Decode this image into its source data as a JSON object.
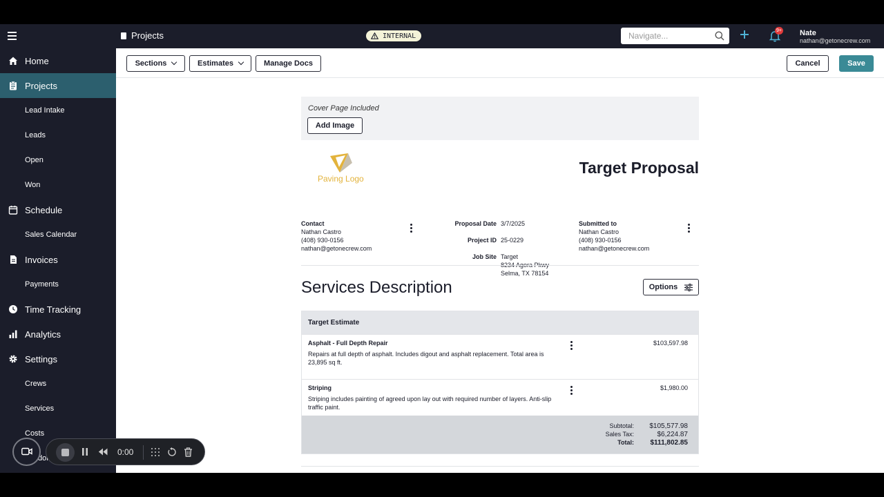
{
  "topbar": {
    "title": "Projects",
    "badge": "INTERNAL",
    "navigate_placeholder": "Navigate...",
    "notif_count": "9+",
    "user_name": "Nate",
    "user_email": "nathan@getonecrew.com"
  },
  "sidebar": {
    "items": [
      {
        "label": "Home",
        "icon": "home-icon",
        "sub": false
      },
      {
        "label": "Projects",
        "icon": "clipboard-icon",
        "sub": false,
        "active": true
      },
      {
        "label": "Lead Intake",
        "sub": true
      },
      {
        "label": "Leads",
        "sub": true
      },
      {
        "label": "Open",
        "sub": true
      },
      {
        "label": "Won",
        "sub": true
      },
      {
        "label": "Schedule",
        "icon": "calendar-icon",
        "sub": false
      },
      {
        "label": "Sales Calendar",
        "sub": true
      },
      {
        "label": "Invoices",
        "icon": "document-icon",
        "sub": false
      },
      {
        "label": "Payments",
        "sub": true
      },
      {
        "label": "Time Tracking",
        "icon": "clock-icon",
        "sub": false
      },
      {
        "label": "Analytics",
        "icon": "bar-chart-icon",
        "sub": false
      },
      {
        "label": "Settings",
        "icon": "gear-icon",
        "sub": false
      },
      {
        "label": "Crews",
        "sub": true
      },
      {
        "label": "Services",
        "sub": true
      },
      {
        "label": "Costs",
        "sub": true
      },
      {
        "label": "Vendors",
        "sub": true
      }
    ]
  },
  "toolbar": {
    "sections": "Sections",
    "estimates": "Estimates",
    "manage_docs": "Manage Docs",
    "cancel": "Cancel",
    "save": "Save"
  },
  "doc": {
    "cover_text": "Cover Page Included",
    "add_image": "Add Image",
    "logo_text": "Paving Logo",
    "title": "Target Proposal",
    "contact": {
      "heading": "Contact",
      "name": "Nathan Castro",
      "phone": "(408) 930-0156",
      "email": "nathan@getonecrew.com"
    },
    "meta": {
      "proposal_date_label": "Proposal Date",
      "proposal_date": "3/7/2025",
      "project_id_label": "Project ID",
      "project_id": "25-0229",
      "job_site_label": "Job Site",
      "job_site_1": "Target",
      "job_site_2": "8234 Agora Pkwy",
      "job_site_3": "Selma, TX 78154"
    },
    "submitted": {
      "heading": "Submitted to",
      "name": "Nathan Castro",
      "phone": "(408) 930-0156",
      "email": "nathan@getonecrew.com"
    },
    "services_title": "Services Description",
    "options": "Options",
    "estimate": {
      "name": "Target Estimate",
      "rows": [
        {
          "name": "Asphalt - Full Depth Repair",
          "desc": "Repairs at full depth of asphalt. Includes digout and asphalt replacement. Total area is 23,895 sq ft.",
          "amount": "$103,597.98"
        },
        {
          "name": "Striping",
          "desc": "Striping includes painting of agreed upon lay out with required number of layers. Anti-slip traffic paint.",
          "amount": "$1,980.00"
        }
      ],
      "subtotal_label": "Subtotal:",
      "subtotal": "$105,577.98",
      "tax_label": "Sales Tax:",
      "tax": "$6,224.87",
      "total_label": "Total:",
      "total": "$111,802.85"
    }
  },
  "recorder": {
    "time": "0:00"
  },
  "colors": {
    "sidebar_bg": "#1b1d2a",
    "active_bg": "#2c5f6e",
    "save_bg": "#3a8a96",
    "plus": "#4fb2d4",
    "badge_red": "#e23b3b"
  }
}
